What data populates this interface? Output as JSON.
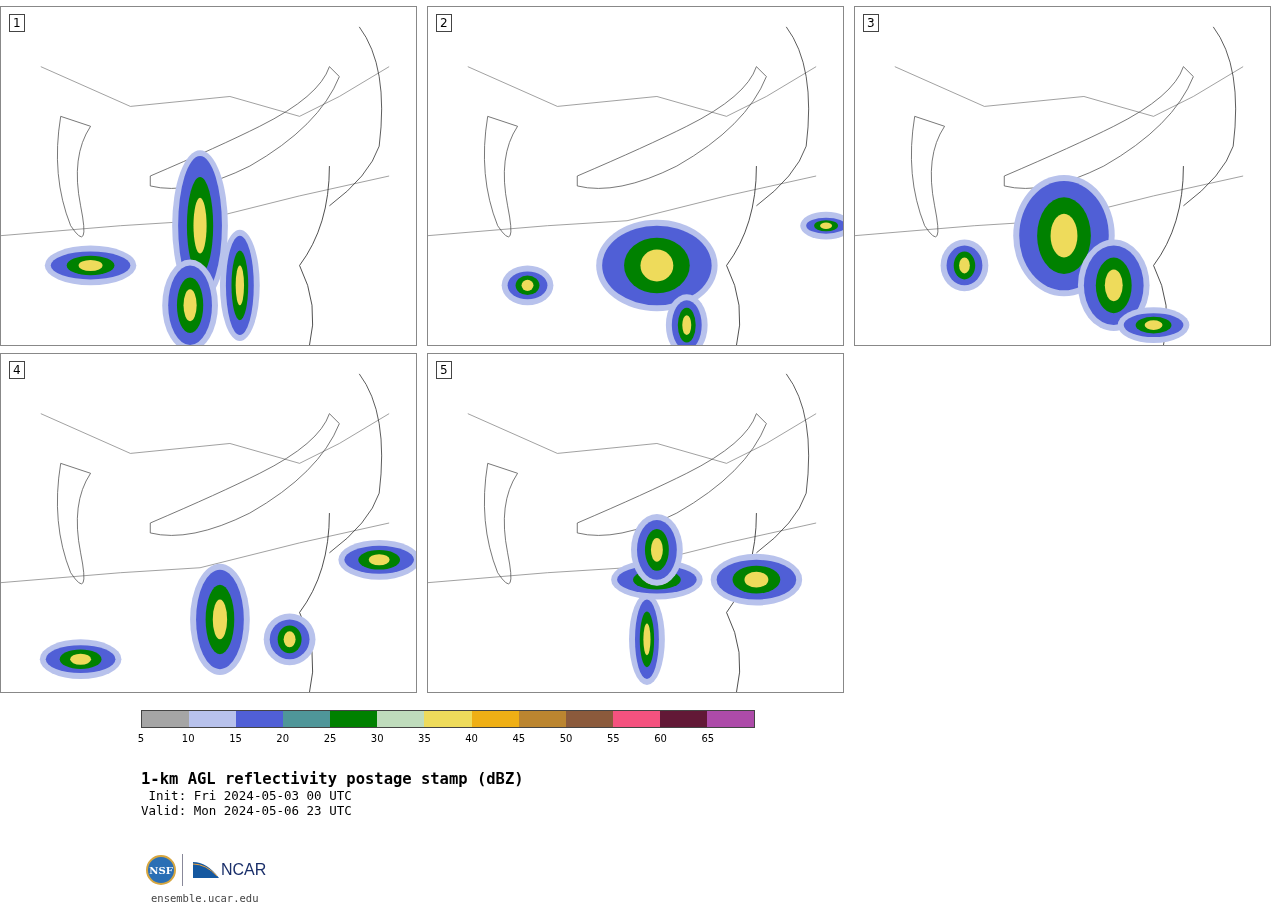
{
  "panels": [
    {
      "label": "1"
    },
    {
      "label": "2"
    },
    {
      "label": "3"
    },
    {
      "label": "4"
    },
    {
      "label": "5"
    }
  ],
  "colorbar": {
    "segments": [
      {
        "color": "#a5a5a5"
      },
      {
        "color": "#b8c2ec"
      },
      {
        "color": "#505fd6"
      },
      {
        "color": "#4f9699"
      },
      {
        "color": "#008100"
      },
      {
        "color": "#bfdcbc"
      },
      {
        "color": "#eedb5b"
      },
      {
        "color": "#efaf15"
      },
      {
        "color": "#bb8530"
      },
      {
        "color": "#8b5a3c"
      },
      {
        "color": "#f5527f"
      },
      {
        "color": "#621836"
      },
      {
        "color": "#ad4ba9"
      }
    ],
    "ticks": [
      "5",
      "10",
      "15",
      "20",
      "25",
      "30",
      "35",
      "40",
      "45",
      "50",
      "55",
      "60",
      "65"
    ]
  },
  "title": "1-km AGL reflectivity postage stamp (dBZ)",
  "init": " Init: Fri 2024-05-03 00 UTC",
  "valid": "Valid: Mon 2024-05-06 23 UTC",
  "logos": {
    "left": "NSF",
    "right": "NCAR"
  },
  "site": "ensemble.ucar.edu"
}
